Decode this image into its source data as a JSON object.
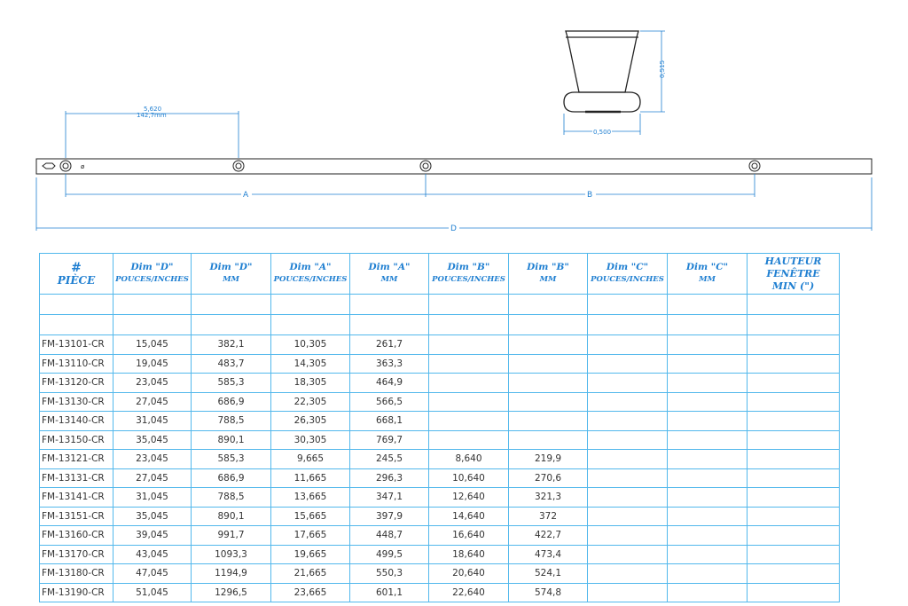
{
  "drawing": {
    "profile_height_dim": "0,515",
    "profile_width_dim": "0,500",
    "offset_dim_inches": "5,620",
    "offset_dim_mm": "142,7mm",
    "label_a": "A",
    "label_b": "B",
    "label_d": "D",
    "end_mark": "ø"
  },
  "table": {
    "headers": [
      [
        "#",
        "PIÈCE"
      ],
      [
        "Dim \"D\"",
        "POUCES/INCHES"
      ],
      [
        "Dim \"D\"",
        "MM"
      ],
      [
        "Dim \"A\"",
        "POUCES/INCHES"
      ],
      [
        "Dim \"A\"",
        "MM"
      ],
      [
        "Dim \"B\"",
        "POUCES/INCHES"
      ],
      [
        "Dim \"B\"",
        "MM"
      ],
      [
        "Dim \"C\"",
        "POUCES/INCHES"
      ],
      [
        "Dim \"C\"",
        "MM"
      ],
      [
        "HAUTEUR",
        "FENÊTRE",
        "MIN (\")"
      ]
    ],
    "rows": [
      [
        "FM-13101-CR",
        "15,045",
        "382,1",
        "10,305",
        "261,7",
        "",
        "",
        "",
        "",
        ""
      ],
      [
        "FM-13110-CR",
        "19,045",
        "483,7",
        "14,305",
        "363,3",
        "",
        "",
        "",
        "",
        ""
      ],
      [
        "FM-13120-CR",
        "23,045",
        "585,3",
        "18,305",
        "464,9",
        "",
        "",
        "",
        "",
        ""
      ],
      [
        "FM-13130-CR",
        "27,045",
        "686,9",
        "22,305",
        "566,5",
        "",
        "",
        "",
        "",
        ""
      ],
      [
        "FM-13140-CR",
        "31,045",
        "788,5",
        "26,305",
        "668,1",
        "",
        "",
        "",
        "",
        ""
      ],
      [
        "FM-13150-CR",
        "35,045",
        "890,1",
        "30,305",
        "769,7",
        "",
        "",
        "",
        "",
        ""
      ],
      [
        "FM-13121-CR",
        "23,045",
        "585,3",
        "9,665",
        "245,5",
        "8,640",
        "219,9",
        "",
        "",
        ""
      ],
      [
        "FM-13131-CR",
        "27,045",
        "686,9",
        "11,665",
        "296,3",
        "10,640",
        "270,6",
        "",
        "",
        ""
      ],
      [
        "FM-13141-CR",
        "31,045",
        "788,5",
        "13,665",
        "347,1",
        "12,640",
        "321,3",
        "",
        "",
        ""
      ],
      [
        "FM-13151-CR",
        "35,045",
        "890,1",
        "15,665",
        "397,9",
        "14,640",
        "372",
        "",
        "",
        ""
      ],
      [
        "FM-13160-CR",
        "39,045",
        "991,7",
        "17,665",
        "448,7",
        "16,640",
        "422,7",
        "",
        "",
        ""
      ],
      [
        "FM-13170-CR",
        "43,045",
        "1093,3",
        "19,665",
        "499,5",
        "18,640",
        "473,4",
        "",
        "",
        ""
      ],
      [
        "FM-13180-CR",
        "47,045",
        "1194,9",
        "21,665",
        "550,3",
        "20,640",
        "524,1",
        "",
        "",
        ""
      ],
      [
        "FM-13190-CR",
        "51,045",
        "1296,5",
        "23,665",
        "601,1",
        "22,640",
        "574,8",
        "",
        "",
        ""
      ]
    ]
  },
  "colors": {
    "dimension_blue": "#1f7fd1",
    "grid_blue": "#52b8ec",
    "line_black": "#222222"
  }
}
